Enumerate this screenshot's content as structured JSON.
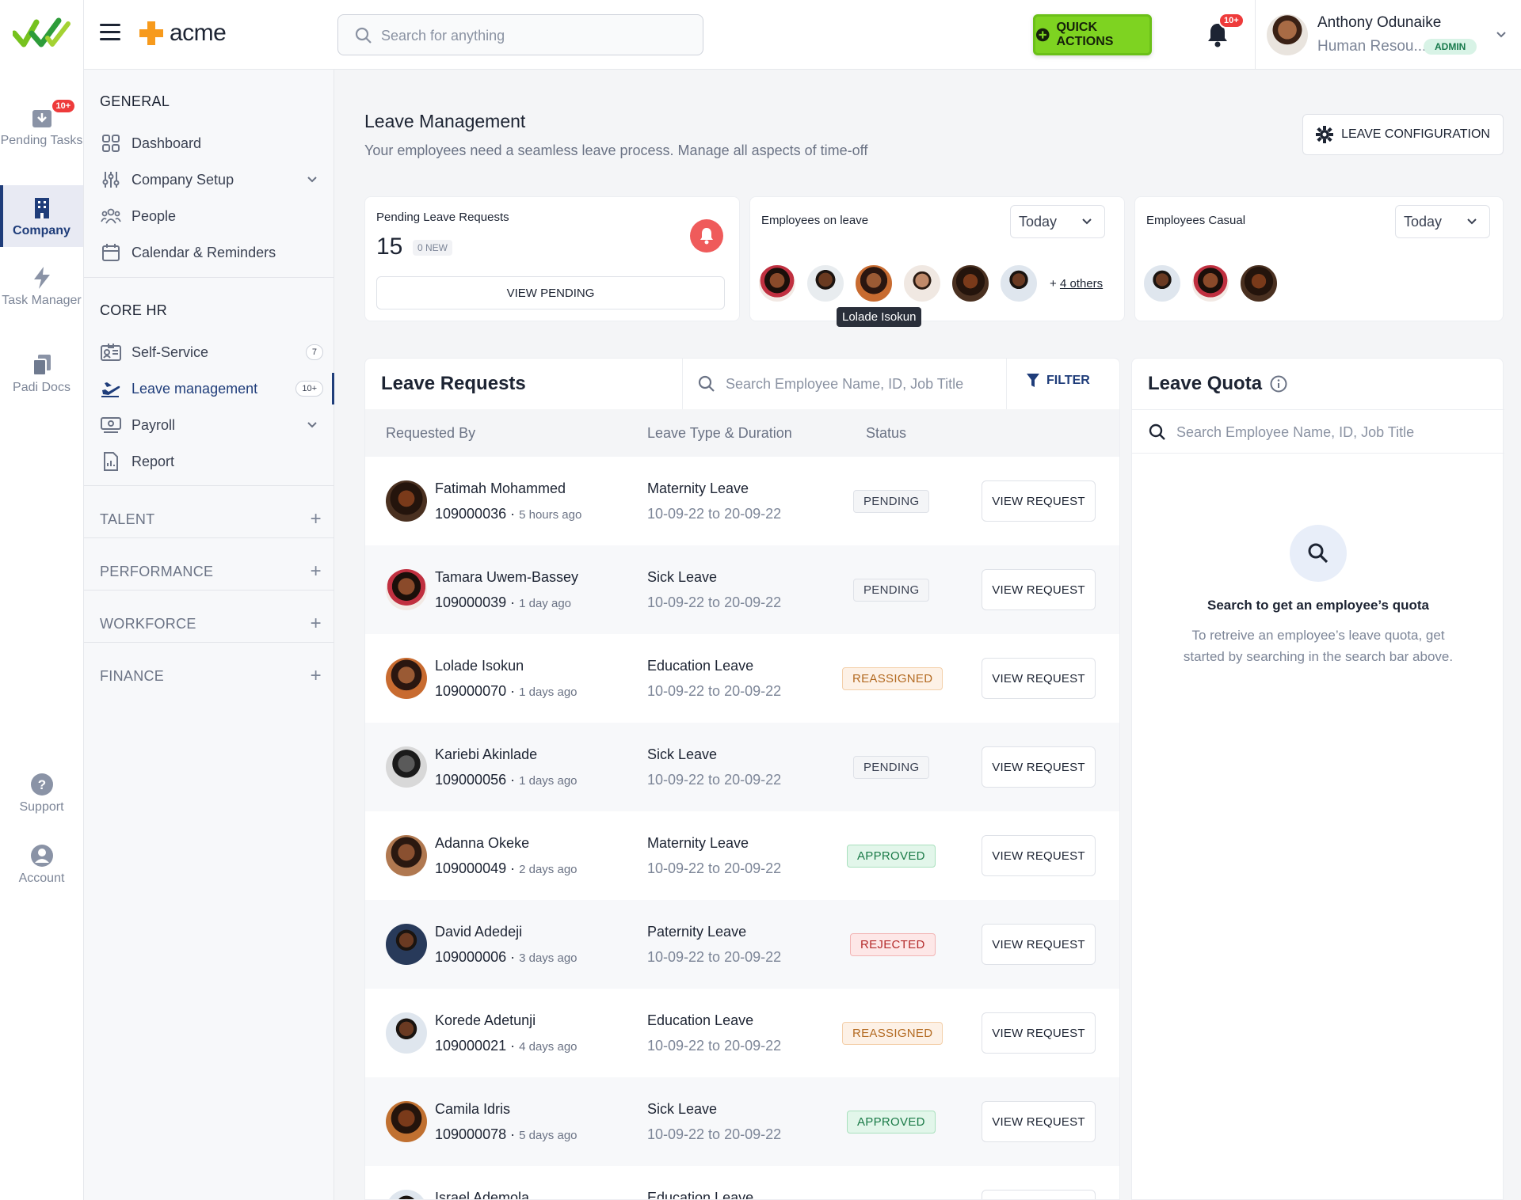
{
  "rail": {
    "items": [
      {
        "label": "Pending Tasks",
        "badge": "10+"
      },
      {
        "label": "Company"
      },
      {
        "label": "Task Manager"
      },
      {
        "label": "Padi Docs"
      },
      {
        "label": "Support"
      },
      {
        "label": "Account"
      }
    ]
  },
  "header": {
    "brand": "acme",
    "search_placeholder": "Search for anything",
    "quick_actions": "QUICK ACTIONS",
    "notification_badge": "10+",
    "user": {
      "name": "Anthony Odunaike",
      "role": "Human Resou...",
      "badge": "ADMIN"
    }
  },
  "sidebar": {
    "general_title": "GENERAL",
    "general": [
      {
        "label": "Dashboard"
      },
      {
        "label": "Company Setup"
      },
      {
        "label": "People"
      },
      {
        "label": "Calendar & Reminders"
      }
    ],
    "core_title": "CORE HR",
    "core": [
      {
        "label": "Self-Service",
        "count": "7"
      },
      {
        "label": "Leave management",
        "count": "10+"
      },
      {
        "label": "Payroll"
      },
      {
        "label": "Report"
      }
    ],
    "sections": [
      "TALENT",
      "PERFORMANCE",
      "WORKFORCE",
      "FINANCE"
    ]
  },
  "page": {
    "title": "Leave Management",
    "subtitle": "Your employees need a seamless leave process. Manage all aspects of time-off",
    "config_button": "LEAVE CONFIGURATION"
  },
  "cards": {
    "pending": {
      "label": "Pending Leave Requests",
      "count": "15",
      "new": "0 NEW",
      "button": "VIEW PENDING"
    },
    "on_leave": {
      "label": "Employees on leave",
      "period": "Today",
      "others": "4 others",
      "plus": "+",
      "tooltip": "Lolade Isokun"
    },
    "casual": {
      "label": "Employees Casual",
      "period": "Today"
    }
  },
  "requests": {
    "title": "Leave Requests",
    "search_placeholder": "Search Employee Name, ID, Job Title",
    "filter": "FILTER",
    "columns": [
      "Requested By",
      "Leave Type & Duration",
      "Status"
    ],
    "action_label": "VIEW REQUEST",
    "rows": [
      {
        "name": "Fatimah Mohammed",
        "id": "109000036",
        "ago": "5 hours ago",
        "type": "Maternity Leave",
        "duration": "10-09-22 to 20-09-22",
        "status": "PENDING"
      },
      {
        "name": "Tamara Uwem-Bassey",
        "id": "109000039",
        "ago": "1 day ago",
        "type": "Sick Leave",
        "duration": "10-09-22 to 20-09-22",
        "status": "PENDING"
      },
      {
        "name": "Lolade Isokun",
        "id": "109000070",
        "ago": "1 days ago",
        "type": "Education Leave",
        "duration": "10-09-22 to 20-09-22",
        "status": "REASSIGNED"
      },
      {
        "name": "Kariebi Akinlade",
        "id": "109000056",
        "ago": "1 days ago",
        "type": "Sick Leave",
        "duration": "10-09-22 to 20-09-22",
        "status": "PENDING"
      },
      {
        "name": "Adanna Okeke",
        "id": "109000049",
        "ago": "2 days ago",
        "type": "Maternity Leave",
        "duration": "10-09-22 to 20-09-22",
        "status": "APPROVED"
      },
      {
        "name": "David Adedeji",
        "id": "109000006",
        "ago": "3 days ago",
        "type": "Paternity Leave",
        "duration": "10-09-22 to 20-09-22",
        "status": "REJECTED"
      },
      {
        "name": "Korede Adetunji",
        "id": "109000021",
        "ago": "4 days ago",
        "type": "Education Leave",
        "duration": "10-09-22 to 20-09-22",
        "status": "REASSIGNED"
      },
      {
        "name": "Camila Idris",
        "id": "109000078",
        "ago": "5 days ago",
        "type": "Sick Leave",
        "duration": "10-09-22 to 20-09-22",
        "status": "APPROVED"
      },
      {
        "name": "Israel Ademola",
        "id": "",
        "ago": "",
        "type": "Education Leave",
        "duration": "",
        "status": ""
      }
    ]
  },
  "quota": {
    "title": "Leave Quota",
    "search_placeholder": "Search Employee Name, ID, Job Title",
    "empty_title": "Search to get an employee’s quota",
    "empty_desc": "To retreive an employee’s leave quota, get started by searching in the search bar above."
  },
  "colors": {
    "accent": "#1f3d7a",
    "quick_actions": "#7ed321",
    "danger": "#ee3b3b"
  }
}
